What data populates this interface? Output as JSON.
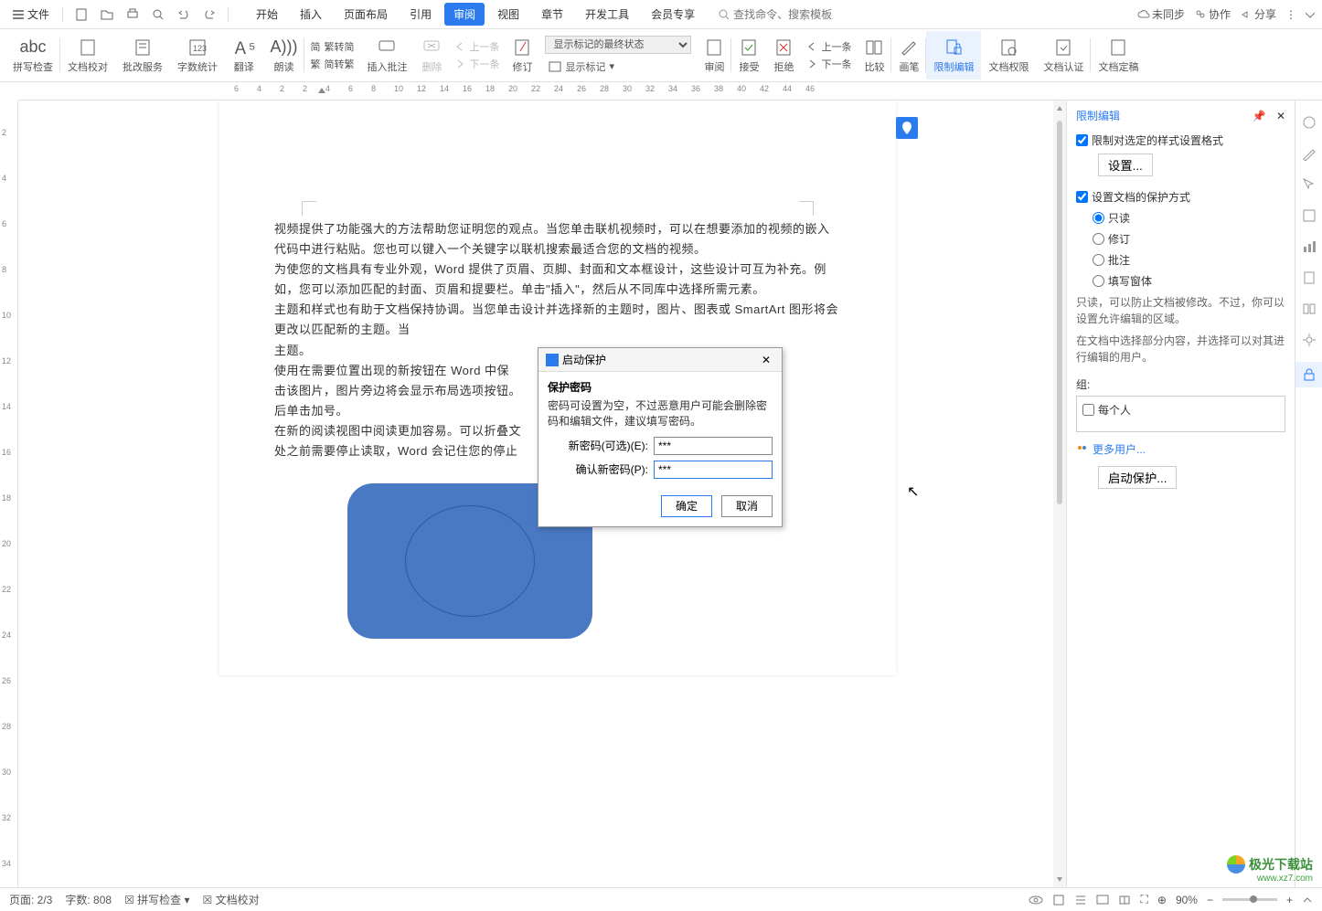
{
  "topbar": {
    "file": "文件",
    "right": {
      "unsync": "未同步",
      "collab": "协作",
      "share": "分享"
    },
    "search_ph": "查找命令、搜索模板"
  },
  "tabs": [
    "开始",
    "插入",
    "页面布局",
    "引用",
    "审阅",
    "视图",
    "章节",
    "开发工具",
    "会员专享"
  ],
  "active_tab": 4,
  "ribbon": {
    "spellcheck": "拼写检查",
    "proofread": "文档校对",
    "batch": "批改服务",
    "wordcount": "字数统计",
    "translate": "翻译",
    "read": "朗读",
    "simpTrad1": "繁转简",
    "simpTrad2": "简转繁",
    "insertComment": "插入批注",
    "delete": "删除",
    "prev": "上一条",
    "next": "下一条",
    "revise": "修订",
    "markShow": "显示标记的最终状态",
    "showMarks": "显示标记",
    "reviewPane": "审阅",
    "accept": "接受",
    "reject": "拒绝",
    "prev2": "上一条",
    "next2": "下一条",
    "compare": "比较",
    "brush": "画笔",
    "restrictEdit": "限制编辑",
    "docPerm": "文档权限",
    "docAuth": "文档认证",
    "docFinal": "文档定稿"
  },
  "ruler_h": [
    "6",
    "4",
    "2",
    "2",
    "4",
    "6",
    "8",
    "10",
    "12",
    "14",
    "16",
    "18",
    "20",
    "22",
    "24",
    "26",
    "28",
    "30",
    "32",
    "34",
    "36",
    "38",
    "40",
    "42",
    "44",
    "46"
  ],
  "ruler_v": [
    "2",
    "4",
    "6",
    "8",
    "10",
    "12",
    "14",
    "16",
    "18",
    "20",
    "22",
    "24",
    "26",
    "28",
    "30",
    "32",
    "34"
  ],
  "doc": {
    "p1": "视频提供了功能强大的方法帮助您证明您的观点。当您单击联机视频时，可以在想要添加的视频的嵌入代码中进行粘贴。您也可以键入一个关键字以联机搜索最适合您的文档的视频。",
    "p2": "为使您的文档具有专业外观，Word 提供了页眉、页脚、封面和文本框设计，这些设计可互为补充。例如，您可以添加匹配的封面、页眉和提要栏。单击\"插入\"，然后从不同库中选择所需元素。",
    "p3": "主题和样式也有助于文档保持协调。当您单击设计并选择新的主题时，图片、图表或 SmartArt 图形将会更改以匹配新的主题。当",
    "p3b": "主题。",
    "p4": "使用在需要位置出现的新按钮在 Word 中保",
    "p4b": "击该图片，图片旁边将会显示布局选项按钮。",
    "p4c": "后单击加号。",
    "p5": "在新的阅读视图中阅读更加容易。可以折叠文",
    "p5b": "处之前需要停止读取，Word 会记住您的停止"
  },
  "dialog": {
    "title": "启动保护",
    "section": "保护密码",
    "desc": "密码可设置为空，不过恶意用户可能会删除密码和编辑文件，建议填写密码。",
    "pwd1_label": "新密码(可选)(E):",
    "pwd2_label": "确认新密码(P):",
    "pwd_value": "***",
    "ok": "确定",
    "cancel": "取消"
  },
  "rpanel": {
    "title": "限制编辑",
    "chk1": "限制对选定的样式设置格式",
    "btn1": "设置...",
    "chk2": "设置文档的保护方式",
    "opts": [
      "只读",
      "修订",
      "批注",
      "填写窗体"
    ],
    "desc1": "只读，可以防止文档被修改。不过，你可以设置允许编辑的区域。",
    "desc2": "在文档中选择部分内容，并选择可以对其进行编辑的用户。",
    "group_label": "组:",
    "everyone": "每个人",
    "more_users": "更多用户...",
    "start_protect": "启动保护..."
  },
  "status": {
    "page": "页面: 2/3",
    "words": "字数: 808",
    "spell": "拼写检查",
    "proof": "文档校对",
    "zoom": "90%"
  },
  "watermark": {
    "name": "极光下载站",
    "url": "www.xz7.com"
  }
}
